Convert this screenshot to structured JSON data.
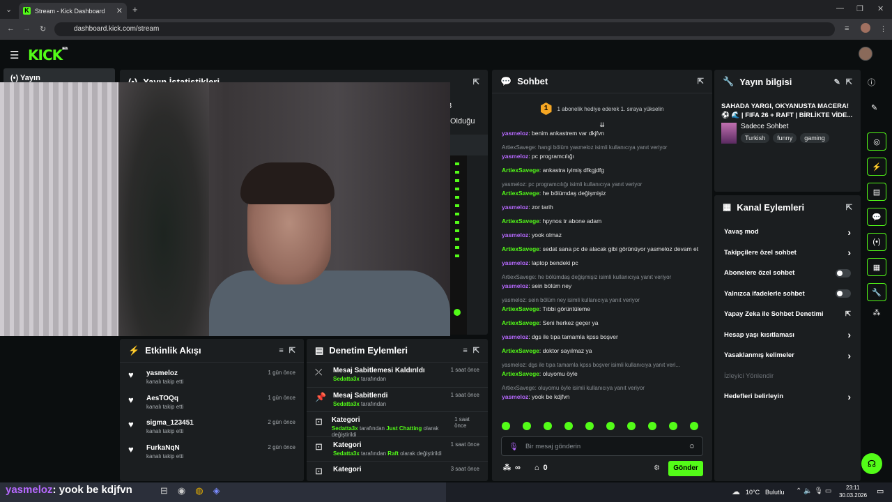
{
  "browser": {
    "tab_title": "Stream - Kick Dashboard",
    "url": "dashboard.kick.com/stream"
  },
  "kick": {
    "logo": "KICK",
    "beta": "BETA"
  },
  "sidebar": {
    "active_item": "Yayın"
  },
  "stats_panel": {
    "title": "Yayın İstatistikleri",
    "partial_value": "8",
    "partial_label": "Olduğu"
  },
  "activity": {
    "title": "Etkinlik Akışı",
    "items": [
      {
        "name": "yasmeloz",
        "sub": "kanalı takip etti",
        "time": "1 gün önce"
      },
      {
        "name": "AesTOQq",
        "sub": "kanalı takip etti",
        "time": "1 gün önce"
      },
      {
        "name": "sigma_123451",
        "sub": "kanalı takip etti",
        "time": "2 gün önce"
      },
      {
        "name": "FurkaNqN",
        "sub": "kanalı takip etti",
        "time": "2 gün önce"
      }
    ]
  },
  "moderation": {
    "title": "Denetim Eylemleri",
    "items": [
      {
        "title": "Mesaj Sabitlemesi Kaldırıldı",
        "user": "Sedatta3x",
        "rest": "tarafından",
        "time": "1 saat önce"
      },
      {
        "title": "Mesaj Sabitlendi",
        "user": "Sedatta3x",
        "rest": "tarafından",
        "time": "1 saat önce"
      },
      {
        "title": "Kategori",
        "user": "Sedatta3x",
        "rest": "tarafından",
        "cat": "Just Chatting",
        "rest2": "olarak değiştirildi",
        "time": "1 saat önce"
      },
      {
        "title": "Kategori",
        "user": "Sedatta3x",
        "rest": "tarafından",
        "cat": "Raft",
        "rest2": "olarak değiştirildi",
        "time": "1 saat önce"
      },
      {
        "title": "Kategori",
        "time": "3 saat önce"
      }
    ]
  },
  "chat": {
    "title": "Sohbet",
    "goal": "1 abonelik hediye ederek 1. sıraya yükselin",
    "goal_rank": "1",
    "messages": [
      {
        "user": "yasmeloz",
        "color": "u1",
        "text": "benim ankastrem var dkjfvn"
      },
      {
        "reply": "ArtiexSavege: hangi bölüm yasmeloz isimli kullanıcıya yanıt veriyor",
        "user": "yasmeloz",
        "color": "u1",
        "text": "pc programcılığı"
      },
      {
        "user": "ArtiexSavege",
        "color": "u2",
        "text": "ankastra iyimiş dfkgjdfg"
      },
      {
        "reply": "yasmeloz: pc programcılığı isimli kullanıcıya yanıt veriyor",
        "user": "ArtiexSavege",
        "color": "u2",
        "text": "he bölümdaş değişmişiz"
      },
      {
        "user": "yasmeloz",
        "color": "u1",
        "text": "zor tarih"
      },
      {
        "user": "ArtiexSavege",
        "color": "u2",
        "text": "hpynos tr abone adam"
      },
      {
        "user": "yasmeloz",
        "color": "u1",
        "text": "yook olmaz"
      },
      {
        "user": "ArtiexSavege",
        "color": "u2",
        "text": "sedat sana pc de alacak gibi görünüyor yasmeloz devam et"
      },
      {
        "user": "yasmeloz",
        "color": "u1",
        "text": "laptop bendeki pc"
      },
      {
        "reply": "ArtiexSavege: he bölümdaş değişmişiz isimli kullanıcıya yanıt veriyor",
        "user": "yasmeloz",
        "color": "u1",
        "text": "sein bölüm ney"
      },
      {
        "reply": "yasmeloz: sein bölüm ney isimli kullanıcıya yanıt veriyor",
        "user": "ArtiexSavege",
        "color": "u2",
        "text": "Tıbbi görüntüleme"
      },
      {
        "user": "ArtiexSavege",
        "color": "u2",
        "text": "Seni herkez geçer ya"
      },
      {
        "user": "yasmeloz",
        "color": "u1",
        "text": "dgs ile tıpa tamamla kpss boşver"
      },
      {
        "user": "ArtiexSavege",
        "color": "u2",
        "text": "doktor sayılmaz ya"
      },
      {
        "reply": "yasmeloz: dgs ile tıpa tamamla kpss boşver isimli kullanıcıya yanıt veri...",
        "user": "ArtiexSavege",
        "color": "u2",
        "text": "oluyomu öyle"
      },
      {
        "reply": "ArtiexSavege: oluyomu öyle isimli kullanıcıya yanıt veriyor",
        "user": "yasmeloz",
        "color": "u1",
        "text": "yook be kdjfvn"
      }
    ],
    "input_placeholder": "Bir mesaj gönderin",
    "points": "0",
    "send": "Gönder",
    "infinity": "∞"
  },
  "stream_info": {
    "title": "Yayın bilgisi",
    "stream_title": "SAHADA YARGI, OKYANUSTA MACERA! ⚽ 🌊 | FIFA 26 + RAFT | BİRLİKTE VİDE...",
    "category": "Sadece Sohbet",
    "tags": [
      "Turkish",
      "funny",
      "gaming"
    ]
  },
  "channel_actions": {
    "title": "Kanal Eylemleri",
    "items": [
      {
        "label": "Yavaş mod",
        "kind": "chevron"
      },
      {
        "label": "Takipçilere özel sohbet",
        "kind": "chevron"
      },
      {
        "label": "Abonelere özel sohbet",
        "kind": "toggle"
      },
      {
        "label": "Yalnızca ifadelerle sohbet",
        "kind": "toggle"
      },
      {
        "label": "Yapay Zeka ile Sohbet Denetimi",
        "kind": "external"
      },
      {
        "label": "Hesap yaşı kısıtlaması",
        "kind": "chevron"
      },
      {
        "label": "Yasaklanmış kelimeler",
        "kind": "chevron"
      },
      {
        "label": "İzleyici Yönlendir",
        "kind": "disabled"
      },
      {
        "label": "Hedefleri belirleyin",
        "kind": "chevron"
      }
    ]
  },
  "overlay": {
    "chat_user": "yasmeloz",
    "chat_text": ": yook be kdjfvn"
  },
  "taskbar": {
    "weather": "10°C",
    "weather_desc": "Bulutlu",
    "time": "23:11",
    "date": "30.03.2026"
  }
}
